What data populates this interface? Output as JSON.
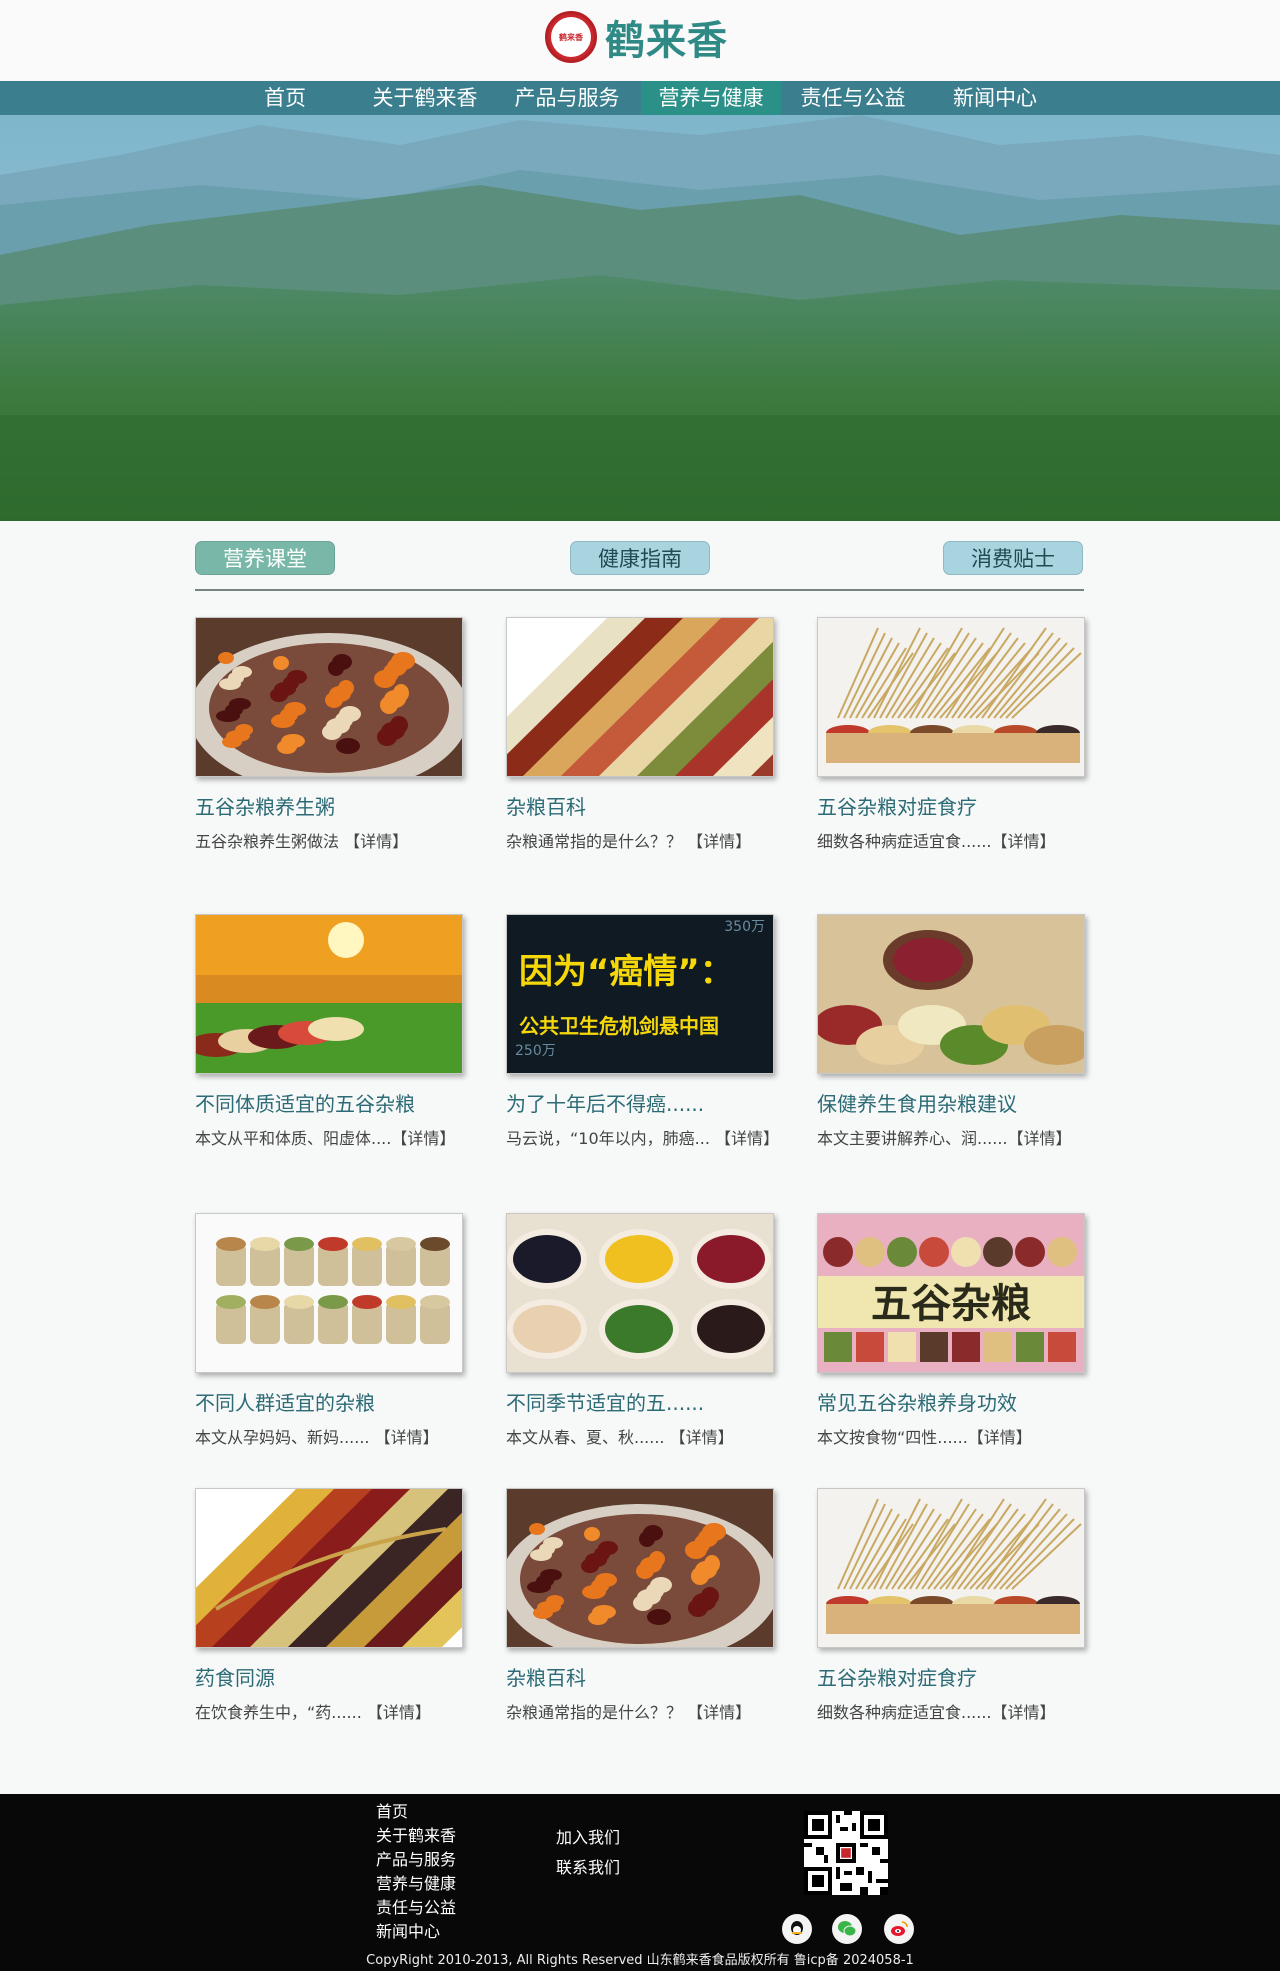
{
  "header": {
    "logo_text": "鹤来香",
    "seal_text": "鹤来香"
  },
  "nav": [
    {
      "label": "首页",
      "active": false
    },
    {
      "label": "关于鹤来香",
      "active": false
    },
    {
      "label": "产品与服务",
      "active": false
    },
    {
      "label": "营养与健康",
      "active": true
    },
    {
      "label": "责任与公益",
      "active": false
    },
    {
      "label": "新闻中心",
      "active": false
    }
  ],
  "tabs": [
    {
      "label": "营养课堂",
      "active": true
    },
    {
      "label": "健康指南",
      "active": false
    },
    {
      "label": "消费贴士",
      "active": false
    }
  ],
  "cards": [
    {
      "title": "五谷杂粮养生粥",
      "desc": "五谷杂粮养生粥做法 【详情】",
      "image": "porridge"
    },
    {
      "title": "杂粮百科",
      "desc": "杂粮通常指的是什么？？ 【详情】",
      "image": "grain-stripes"
    },
    {
      "title": "五谷杂粮对症食疗",
      "desc": "细数各种病症适宜食......【详情】",
      "image": "wheat-bowls"
    },
    {
      "title": "不同体质适宜的五谷杂粮",
      "desc": "本文从平和体质、阳虚体....【详情】",
      "image": "sunset-field"
    },
    {
      "title": "为了十年后不得癌......",
      "desc": "马云说，“10年以内，肺癌... 【详情】",
      "image": "cancer-poster"
    },
    {
      "title": "保健养生食用杂粮建议",
      "desc": "本文主要讲解养心、润......【详情】",
      "image": "beans-jar"
    },
    {
      "title": "不同人群适宜的杂粮",
      "desc": "本文从孕妈妈、新妈...... 【详情】",
      "image": "sacks"
    },
    {
      "title": "不同季节适宜的五......",
      "desc": "本文从春、夏、秋...... 【详情】",
      "image": "grain-bowls"
    },
    {
      "title": "常见五谷杂粮养身功效",
      "desc": "本文按食物“四性......【详情】",
      "image": "wugu-poster"
    },
    {
      "title": "药食同源",
      "desc": "在饮食养生中，“药...... 【详情】",
      "image": "grain-stripes-2"
    },
    {
      "title": "杂粮百科",
      "desc": "杂粮通常指的是什么？？ 【详情】",
      "image": "porridge"
    },
    {
      "title": "五谷杂粮对症食疗",
      "desc": "细数各种病症适宜食......【详情】",
      "image": "wheat-bowls"
    }
  ],
  "poster_cancer": {
    "line1": "因为“癌情”：",
    "line2": "公共卫生危机剑悬中国",
    "n1": "350万",
    "n2": "250万"
  },
  "poster_wugu": {
    "text": "五谷杂粮"
  },
  "footer": {
    "col1": [
      "首页",
      "关于鹤来香",
      "产品与服务",
      "营养与健康",
      "责任与公益",
      "新闻中心"
    ],
    "col2": [
      "加入我们",
      "联系我们"
    ],
    "copyright": "CopyRight 2010-2013, All Rights Reserved 山东鹤来香食品版权所有   鲁icp备 2024058-1",
    "social_icons": [
      "qq-icon",
      "wechat-icon",
      "weibo-icon"
    ]
  }
}
